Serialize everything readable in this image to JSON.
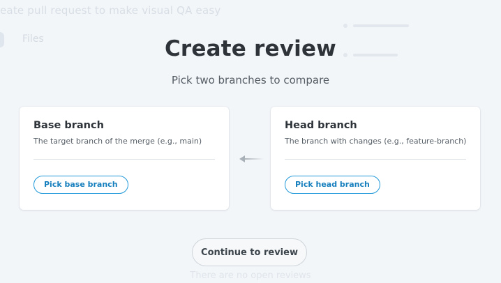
{
  "background": {
    "top_text": "",
    "line_text": "eate pull request to make visual QA easy",
    "nav_label": "Files",
    "footer_text": "There are no open reviews"
  },
  "modal": {
    "title": "Create review",
    "subtitle": "Pick two branches to compare",
    "base": {
      "title": "Base branch",
      "description": "The target branch of the merge (e.g., main)",
      "button_label": "Pick base branch"
    },
    "head": {
      "title": "Head branch",
      "description": "The branch with changes (e.g., feature-branch)",
      "button_label": "Pick head branch"
    },
    "arrow_icon": "arrow-left-icon",
    "continue_label": "Continue to review"
  },
  "colors": {
    "accent": "#1e98d9",
    "background": "#f3f6f9",
    "card": "#ffffff"
  }
}
